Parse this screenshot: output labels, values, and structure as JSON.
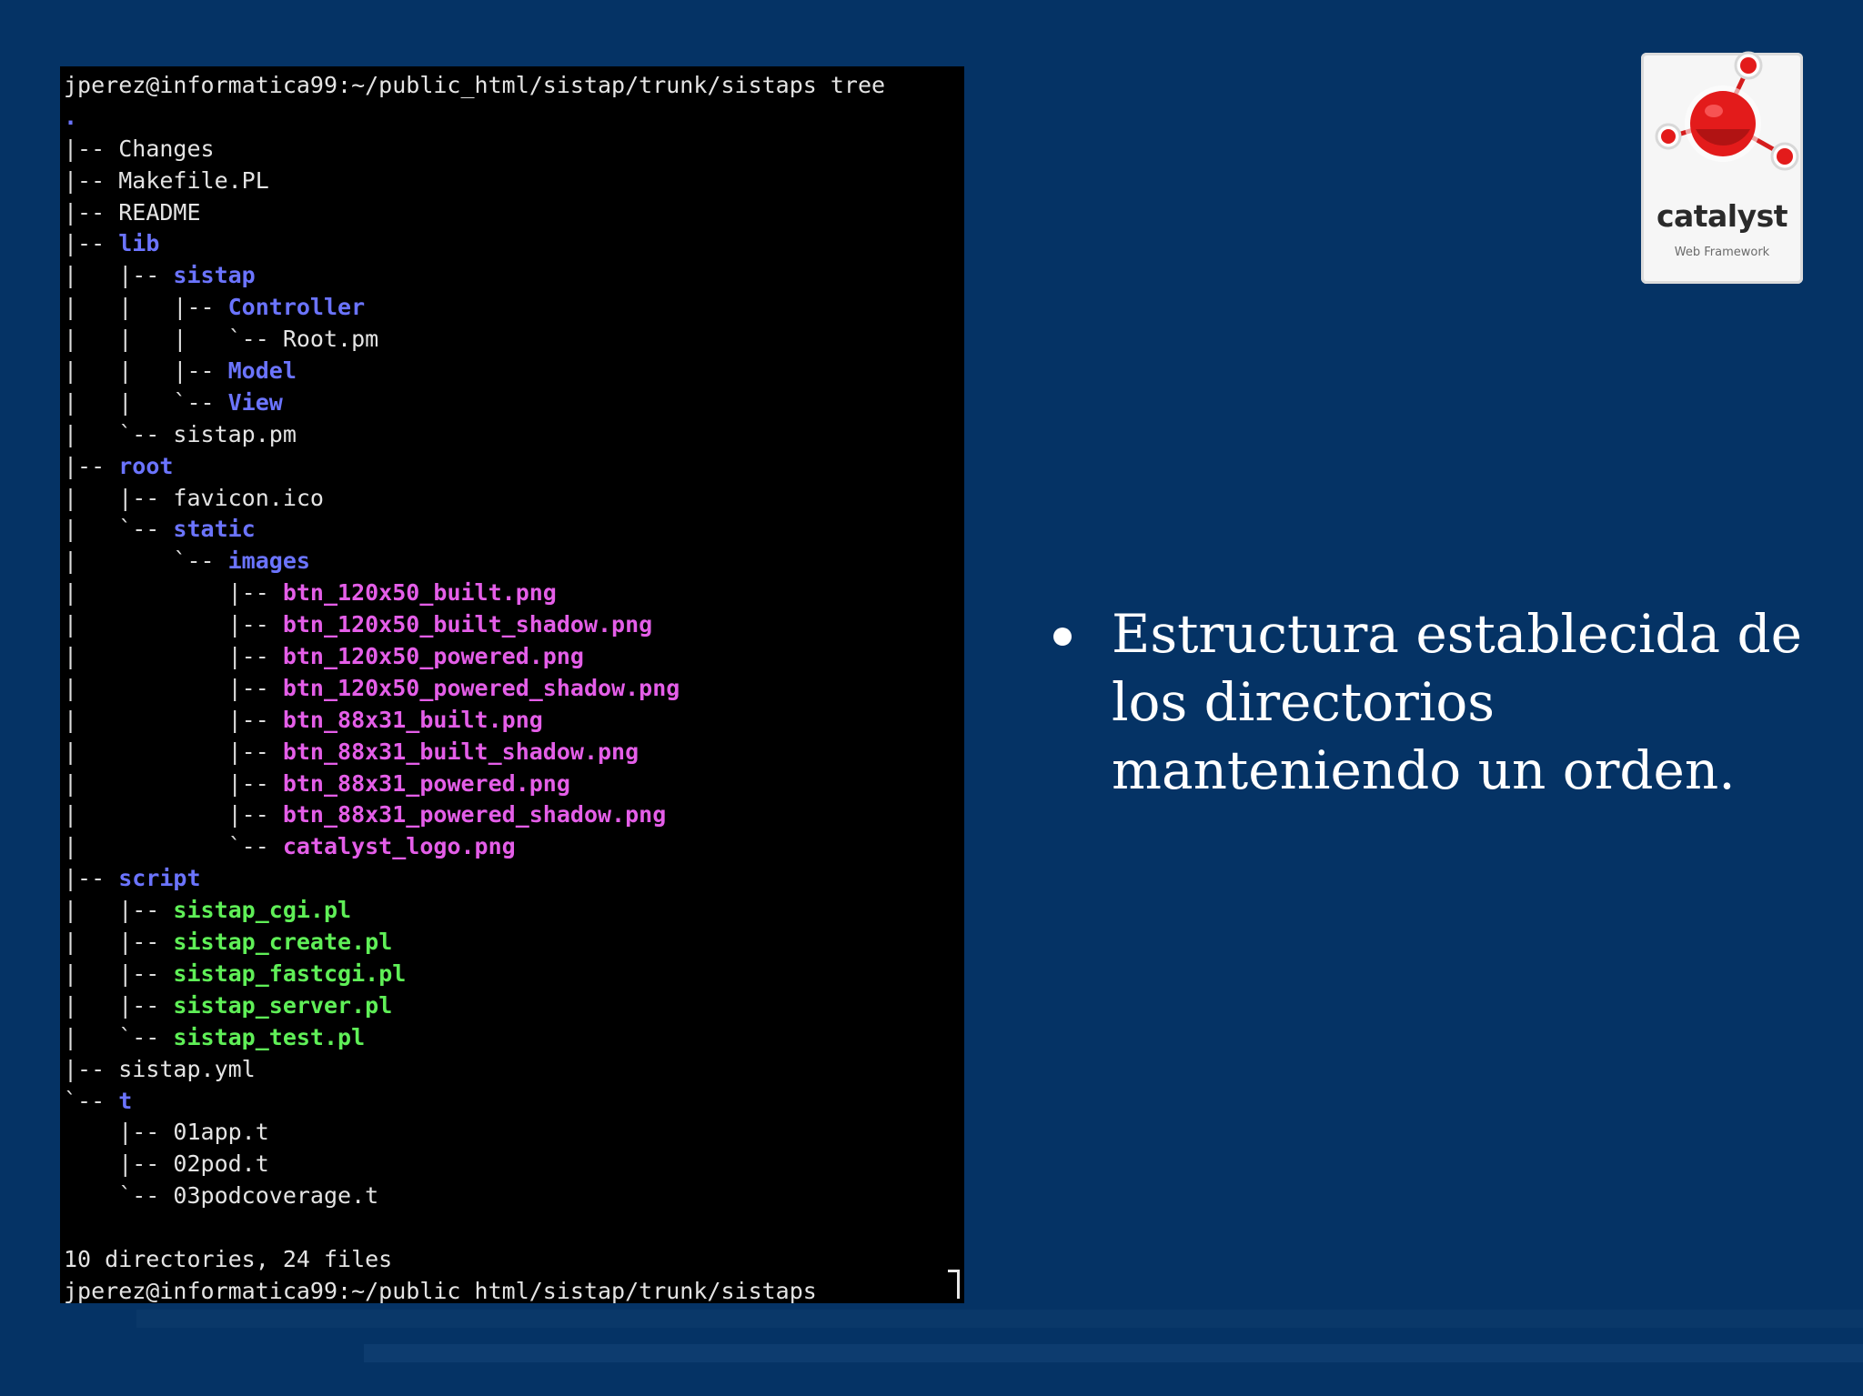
{
  "terminal": {
    "lines": [
      [
        {
          "t": "jperez@informatica99:~/public_html/sistap/trunk/sistaps tree",
          "c": "file"
        }
      ],
      [
        {
          "t": ".",
          "c": "dir"
        }
      ],
      [
        {
          "t": "|-- ",
          "c": "tree"
        },
        {
          "t": "Changes",
          "c": "file"
        }
      ],
      [
        {
          "t": "|-- ",
          "c": "tree"
        },
        {
          "t": "Makefile.PL",
          "c": "file"
        }
      ],
      [
        {
          "t": "|-- ",
          "c": "tree"
        },
        {
          "t": "README",
          "c": "file"
        }
      ],
      [
        {
          "t": "|-- ",
          "c": "tree"
        },
        {
          "t": "lib",
          "c": "dir"
        }
      ],
      [
        {
          "t": "|   |-- ",
          "c": "tree"
        },
        {
          "t": "sistap",
          "c": "dir"
        }
      ],
      [
        {
          "t": "|   |   |-- ",
          "c": "tree"
        },
        {
          "t": "Controller",
          "c": "dir"
        }
      ],
      [
        {
          "t": "|   |   |   `-- ",
          "c": "tree"
        },
        {
          "t": "Root.pm",
          "c": "file"
        }
      ],
      [
        {
          "t": "|   |   |-- ",
          "c": "tree"
        },
        {
          "t": "Model",
          "c": "dir"
        }
      ],
      [
        {
          "t": "|   |   `-- ",
          "c": "tree"
        },
        {
          "t": "View",
          "c": "dir"
        }
      ],
      [
        {
          "t": "|   `-- ",
          "c": "tree"
        },
        {
          "t": "sistap.pm",
          "c": "file"
        }
      ],
      [
        {
          "t": "|-- ",
          "c": "tree"
        },
        {
          "t": "root",
          "c": "dir"
        }
      ],
      [
        {
          "t": "|   |-- ",
          "c": "tree"
        },
        {
          "t": "favicon.ico",
          "c": "file"
        }
      ],
      [
        {
          "t": "|   `-- ",
          "c": "tree"
        },
        {
          "t": "static",
          "c": "dir"
        }
      ],
      [
        {
          "t": "|       `-- ",
          "c": "tree"
        },
        {
          "t": "images",
          "c": "dir"
        }
      ],
      [
        {
          "t": "|           |-- ",
          "c": "tree"
        },
        {
          "t": "btn_120x50_built.png",
          "c": "image"
        }
      ],
      [
        {
          "t": "|           |-- ",
          "c": "tree"
        },
        {
          "t": "btn_120x50_built_shadow.png",
          "c": "image"
        }
      ],
      [
        {
          "t": "|           |-- ",
          "c": "tree"
        },
        {
          "t": "btn_120x50_powered.png",
          "c": "image"
        }
      ],
      [
        {
          "t": "|           |-- ",
          "c": "tree"
        },
        {
          "t": "btn_120x50_powered_shadow.png",
          "c": "image"
        }
      ],
      [
        {
          "t": "|           |-- ",
          "c": "tree"
        },
        {
          "t": "btn_88x31_built.png",
          "c": "image"
        }
      ],
      [
        {
          "t": "|           |-- ",
          "c": "tree"
        },
        {
          "t": "btn_88x31_built_shadow.png",
          "c": "image"
        }
      ],
      [
        {
          "t": "|           |-- ",
          "c": "tree"
        },
        {
          "t": "btn_88x31_powered.png",
          "c": "image"
        }
      ],
      [
        {
          "t": "|           |-- ",
          "c": "tree"
        },
        {
          "t": "btn_88x31_powered_shadow.png",
          "c": "image"
        }
      ],
      [
        {
          "t": "|           `-- ",
          "c": "tree"
        },
        {
          "t": "catalyst_logo.png",
          "c": "image"
        }
      ],
      [
        {
          "t": "|-- ",
          "c": "tree"
        },
        {
          "t": "script",
          "c": "dir"
        }
      ],
      [
        {
          "t": "|   |-- ",
          "c": "tree"
        },
        {
          "t": "sistap_cgi.pl",
          "c": "exec"
        }
      ],
      [
        {
          "t": "|   |-- ",
          "c": "tree"
        },
        {
          "t": "sistap_create.pl",
          "c": "exec"
        }
      ],
      [
        {
          "t": "|   |-- ",
          "c": "tree"
        },
        {
          "t": "sistap_fastcgi.pl",
          "c": "exec"
        }
      ],
      [
        {
          "t": "|   |-- ",
          "c": "tree"
        },
        {
          "t": "sistap_server.pl",
          "c": "exec"
        }
      ],
      [
        {
          "t": "|   `-- ",
          "c": "tree"
        },
        {
          "t": "sistap_test.pl",
          "c": "exec"
        }
      ],
      [
        {
          "t": "|-- ",
          "c": "tree"
        },
        {
          "t": "sistap.yml",
          "c": "file"
        }
      ],
      [
        {
          "t": "`-- ",
          "c": "tree"
        },
        {
          "t": "t",
          "c": "dir"
        }
      ],
      [
        {
          "t": "    |-- ",
          "c": "tree"
        },
        {
          "t": "01app.t",
          "c": "file"
        }
      ],
      [
        {
          "t": "    |-- ",
          "c": "tree"
        },
        {
          "t": "02pod.t",
          "c": "file"
        }
      ],
      [
        {
          "t": "    `-- ",
          "c": "tree"
        },
        {
          "t": "03podcoverage.t",
          "c": "file"
        }
      ],
      [
        {
          "t": "",
          "c": "file"
        }
      ],
      [
        {
          "t": "10 directories, 24 files",
          "c": "file"
        }
      ],
      [
        {
          "t": "jperez@informatica99:~/public_html/sistap/trunk/sistaps",
          "c": "file"
        }
      ]
    ]
  },
  "logo": {
    "word": "catalyst",
    "subtitle": "Web Framework",
    "colors": {
      "accent": "#e31b1b",
      "card": "#f6f6f6"
    }
  },
  "bullet": {
    "text": "Estructura establecida de los directorios manteniendo un orden."
  },
  "colors": {
    "background": "#053365",
    "terminal_bg": "#000000",
    "dir": "#6b74ff",
    "image": "#e45ee8",
    "exec": "#5fef57"
  }
}
